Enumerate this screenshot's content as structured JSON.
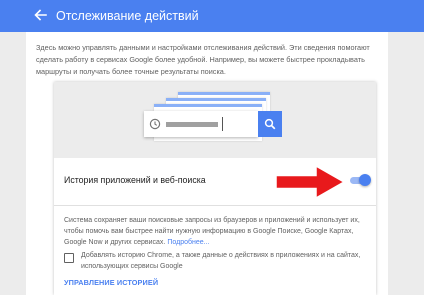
{
  "header": {
    "title": "Отслеживание действий"
  },
  "intro": {
    "text": "Здесь можно управлять данными и настройками отслеживания действий. Эти сведения помогают сделать работу в сервисах Google более удобной. Например, вы можете быстрее прокладывать маршруты и получать более точные результаты поиска."
  },
  "setting": {
    "label": "История приложений и веб-поиска",
    "enabled": true,
    "description": "Система сохраняет ваши поисковые запросы из браузеров и приложений и использует их, чтобы помочь вам быстрее найти нужную информацию в Google Поиске, Google Картах, Google Now и других сервисах.",
    "more_link": "Подробнее...",
    "checkbox_label": "Добавлять историю Chrome, а также данные о действиях в приложениях и на сайтах, использующих сервисы Google",
    "checkbox_checked": false,
    "manage_link": "УПРАВЛЕНИЕ ИСТОРИЕЙ"
  },
  "colors": {
    "accent": "#4a80f0",
    "arrow": "#e8191c"
  }
}
